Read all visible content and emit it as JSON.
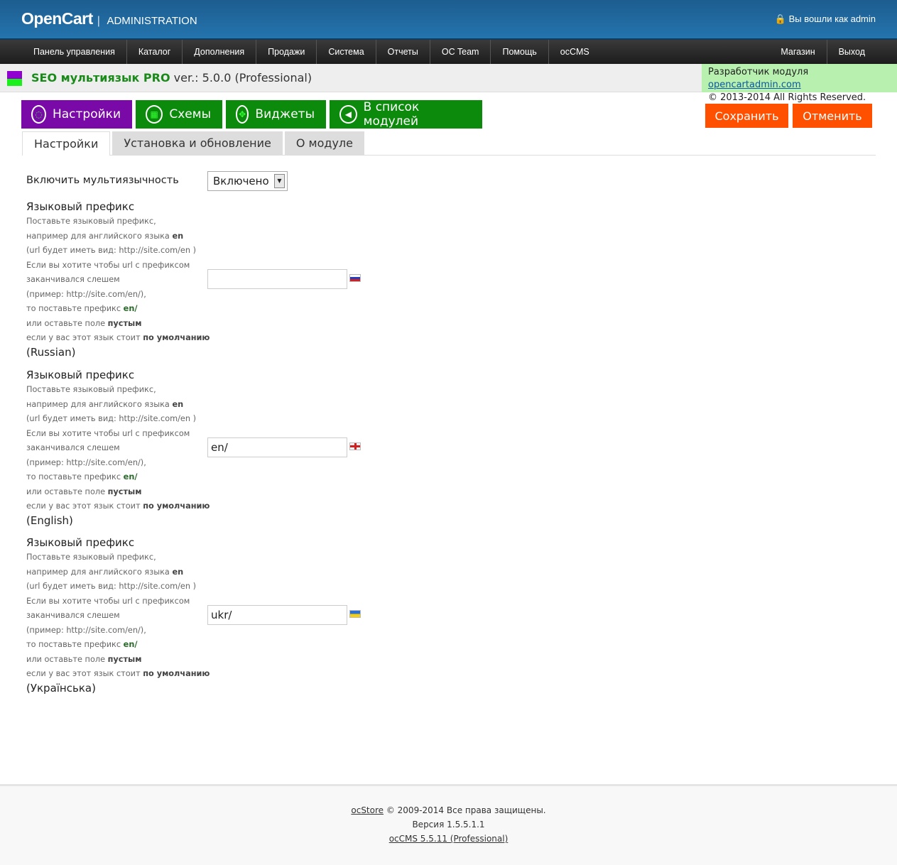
{
  "header": {
    "logo": "OpenCart",
    "separator": "|",
    "subtitle": "ADMINISTRATION",
    "login_text": "Вы вошли как admin"
  },
  "menu": {
    "left": [
      "Панель управления",
      "Каталог",
      "Дополнения",
      "Продажи",
      "Система",
      "Отчеты",
      "OC Team",
      "Помощь",
      "ocCMS"
    ],
    "right": [
      "Магазин",
      "Выход"
    ]
  },
  "titlebar": {
    "name": "SEO мультиязык PRO",
    "version": "ver.: 5.0.0 (Professional)",
    "dev_label": "Разработчик модуля",
    "dev_link": "opencartadmin.com",
    "copyright": "© 2013-2014 All Rights Reserved."
  },
  "buttons": {
    "settings": "Настройки",
    "schemes": "Схемы",
    "widgets": "Виджеты",
    "modules": "В список модулей",
    "save": "Сохранить",
    "cancel": "Отменить"
  },
  "colors": {
    "purple": "#7a0aa8",
    "green": "#0b8a0b",
    "orange": "#ff5000"
  },
  "tabs": [
    "Настройки",
    "Установка и обновление",
    "О модуле"
  ],
  "form": {
    "multilang_label": "Включить мультиязычность",
    "multilang_value": "Включено",
    "help": {
      "title": "Языковый префикс",
      "l1": "Поставьте языковый префикс,",
      "l2": "например для английского языка ",
      "l2b": "en",
      "l3": "(url будет иметь вид: http://site.com/en )",
      "l4": "Если вы хотите чтобы url с префиксом",
      "l5": "заканчивался слешем",
      "l6": "(пример: http://site.com/en/),",
      "l7": "то поставьте префикс ",
      "l7b": "en/",
      "l8": "или оставьте поле ",
      "l8b": "пустым",
      "l9": "если у вас этот язык стоит ",
      "l9b": "по умолчанию"
    },
    "languages": [
      {
        "name": "(Russian)",
        "value": "",
        "flag": "ru-flag-icon"
      },
      {
        "name": "(English)",
        "value": "en/",
        "flag": "gb-flag-icon"
      },
      {
        "name": "(Українська)",
        "value": "ukr/",
        "flag": "ua-flag-icon"
      }
    ]
  },
  "footer": {
    "brand": "ocStore",
    "copy": " © 2009-2014 Все права защищены.",
    "version": "Версия 1.5.5.1.1",
    "cms": "ocCMS 5.5.11 (Professional)"
  }
}
